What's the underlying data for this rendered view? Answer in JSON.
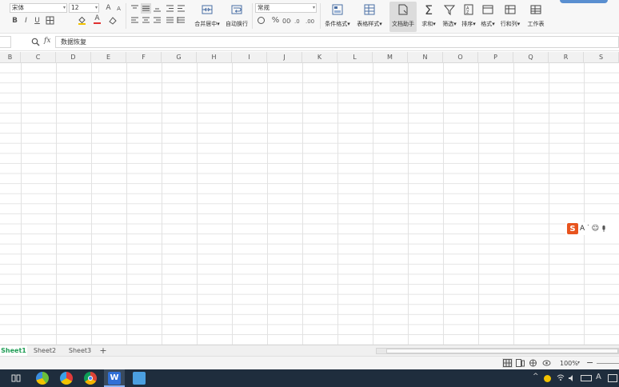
{
  "ribbon": {
    "font_name": "宋体",
    "font_size": "12",
    "merge_center": "合并居中",
    "auto_wrap": "自动换行",
    "number_format": "常规",
    "cond_format": "条件格式",
    "table_style": "表格样式",
    "doc_assistant": "文档助手",
    "sum": "求和",
    "filter": "筛选",
    "sort": "排序",
    "format": "格式",
    "row_col": "行和列",
    "worksheet": "工作表",
    "bold": "B",
    "italic": "I",
    "underline": "U",
    "font_color_glyph": "A",
    "percent": "%",
    "grow_font": "A",
    "shrink_font": "A",
    "dropdown_mark": "▾",
    "sum_glyph": "Σ"
  },
  "formula_bar": {
    "fx_label": "fx",
    "content": "数据恢复"
  },
  "columns": [
    "B",
    "C",
    "D",
    "E",
    "F",
    "G",
    "H",
    "I",
    "J",
    "K",
    "L",
    "M",
    "N",
    "O",
    "P",
    "Q",
    "R",
    "S"
  ],
  "sheets": [
    {
      "label": "Sheet1",
      "active": true
    },
    {
      "label": "Sheet2",
      "active": false
    },
    {
      "label": "Sheet3",
      "active": false
    }
  ],
  "add_sheet": "+",
  "status": {
    "zoom": "100%",
    "zoom_out": "−"
  },
  "ime": {
    "logo": "S",
    "mode": "A",
    "punct": "˙",
    "emoji": "☺"
  },
  "taskbar": {
    "wps_letter": "W",
    "input_lang": "A"
  },
  "colors": {
    "active_sheet": "#1f9d55",
    "taskbar": "#1f2d3d",
    "ime_logo": "#e8541e"
  }
}
